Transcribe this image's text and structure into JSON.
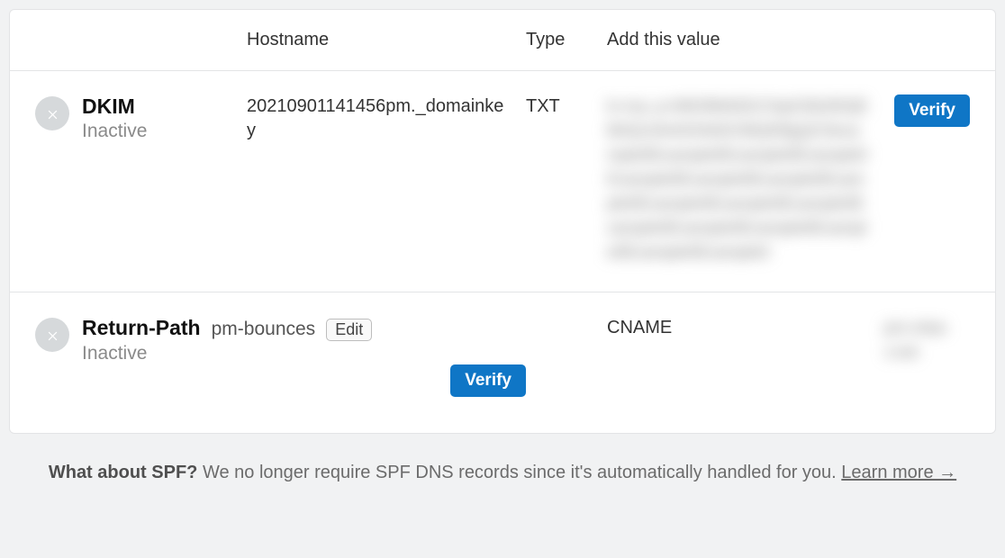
{
  "headers": {
    "hostname": "Hostname",
    "type": "Type",
    "value": "Add this value"
  },
  "records": [
    {
      "name": "DKIM",
      "status": "Inactive",
      "hostname": "20210901141456pm._domainkey",
      "type": "TXT",
      "value_redacted": "k=rsa; p=MIGfMA0GCSqGSIb3DQEBAQUAA4GNADCBiQKBgQC0example0Example0Example0Example0Example0Example0Example0Example0Example0Example0Example0Example0Example0Example0Example0Example0Example0",
      "verify_label": "Verify"
    },
    {
      "name": "Return-Path",
      "status": "Inactive",
      "hostname": "pm-bounces",
      "edit_label": "Edit",
      "type": "CNAME",
      "value_redacted": "pm.mtasv.net",
      "verify_label": "Verify"
    }
  ],
  "footer": {
    "bold": "What about SPF?",
    "text": "We no longer require SPF DNS records since it's automatically handled for you.",
    "learn": "Learn more →"
  }
}
